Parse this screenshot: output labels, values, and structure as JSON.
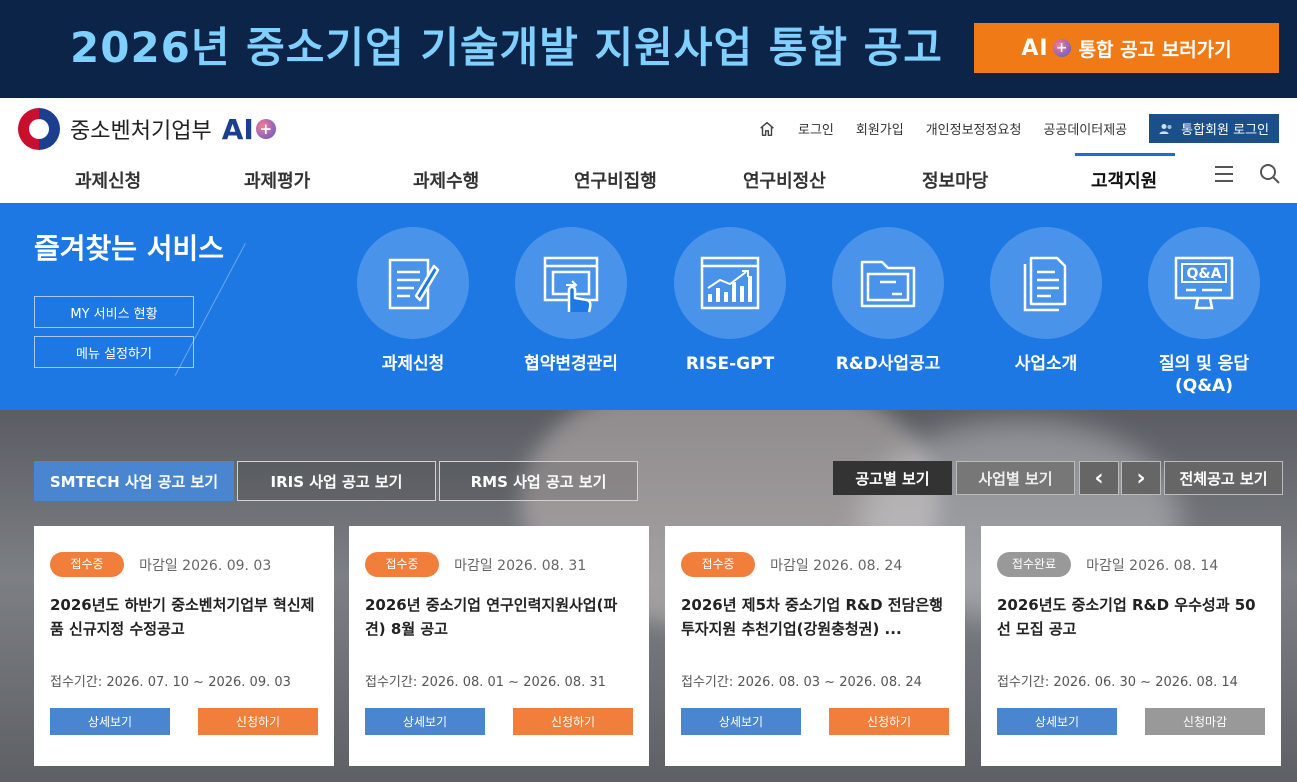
{
  "banner": {
    "title": "2026년 중소기업 기술개발 지원사업 통합 공고",
    "button_ai": "AI",
    "button_label": "통합 공고 보러가기"
  },
  "header": {
    "logo_text": "중소벤처기업부",
    "logo_ai": "AI",
    "util_links": [
      "로그인",
      "회원가입",
      "개인정보정정요청",
      "공공데이터제공"
    ],
    "util_login_label": "통합회원 로그인"
  },
  "gnb": {
    "items": [
      "과제신청",
      "과제평가",
      "과제수행",
      "연구비집행",
      "연구비정산",
      "정보마당",
      "고객지원"
    ],
    "active_index": 6
  },
  "services": {
    "title": "즐겨찾는 서비스",
    "btn_my": "MY 서비스 현황",
    "btn_menu": "메뉴 설정하기",
    "items": [
      {
        "label": "과제신청",
        "icon": "document-pen-icon"
      },
      {
        "label": "협약변경관리",
        "icon": "touch-screen-icon"
      },
      {
        "label": "RISE-GPT",
        "icon": "growth-chart-icon"
      },
      {
        "label": "R&D사업공고",
        "icon": "folder-icon"
      },
      {
        "label": "사업소개",
        "icon": "documents-icon"
      },
      {
        "label": "질의 및 응답\n(Q&A)",
        "icon": "qa-monitor-icon"
      }
    ]
  },
  "main": {
    "tabs": [
      "SMTECH 사업 공고 보기",
      "IRIS 사업 공고 보기",
      "RMS 사업 공고 보기"
    ],
    "view_by_notice": "공고별 보기",
    "view_by_business": "사업별 보기",
    "prev_label": "‹",
    "next_label": "›",
    "all_notices": "전체공고 보기",
    "cards": [
      {
        "status": "접수중",
        "status_type": "open",
        "deadline": "마감일 2026. 09. 03",
        "title": "2026년도 하반기 중소벤처기업부 혁신제품 신규지정 수정공고",
        "period": "접수기간: 2026. 07. 10 ~ 2026. 09. 03",
        "detail": "상세보기",
        "apply": "신청하기",
        "apply_type": "apply"
      },
      {
        "status": "접수중",
        "status_type": "open",
        "deadline": "마감일 2026. 08. 31",
        "title": "2026년 중소기업 연구인력지원사업(파견) 8월 공고",
        "period": "접수기간: 2026. 08. 01 ~ 2026. 08. 31",
        "detail": "상세보기",
        "apply": "신청하기",
        "apply_type": "apply"
      },
      {
        "status": "접수중",
        "status_type": "open",
        "deadline": "마감일 2026. 08. 24",
        "title": "2026년 제5차 중소기업 R&D 전담은행 투자지원 추천기업(강원충청권) ...",
        "period": "접수기간: 2026. 08. 03 ~ 2026. 08. 24",
        "detail": "상세보기",
        "apply": "신청하기",
        "apply_type": "apply"
      },
      {
        "status": "접수완료",
        "status_type": "closed",
        "deadline": "마감일 2026. 08. 14",
        "title": "2026년도 중소기업 R&D 우수성과 50선 모집 공고",
        "period": "접수기간: 2026. 06. 30 ~ 2026. 08. 14",
        "detail": "상세보기",
        "apply": "신청마감",
        "apply_type": "disabled"
      }
    ]
  }
}
